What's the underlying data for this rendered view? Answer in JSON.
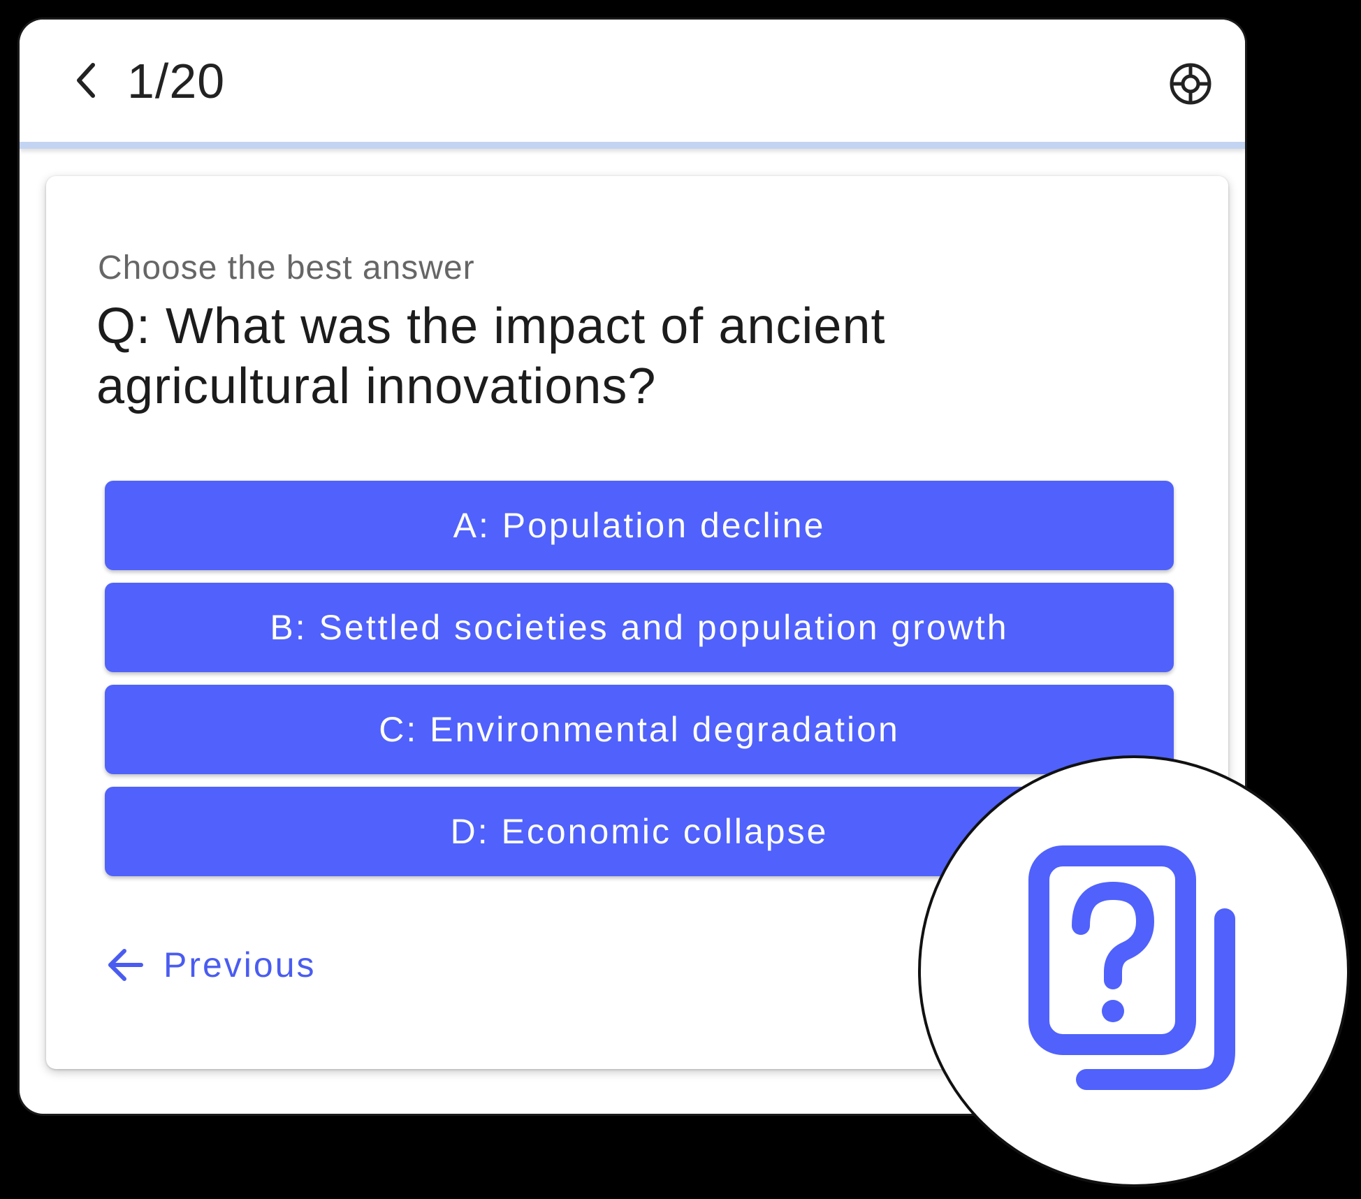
{
  "header": {
    "counter": "1/20",
    "back_icon": "chevron-left-icon",
    "language_icon": "globe-icon"
  },
  "card": {
    "prompt": "Choose the best answer",
    "question": "Q: What was the impact of ancient agricultural innovations?",
    "options": [
      {
        "label": "A: Population decline"
      },
      {
        "label": "B: Settled societies and population growth"
      },
      {
        "label": "C: Environmental degradation"
      },
      {
        "label": "D: Economic collapse"
      }
    ],
    "previous_label": "Previous",
    "previous_icon": "arrow-left-icon"
  },
  "badge": {
    "icon": "question-cards-icon"
  },
  "colors": {
    "accent": "#5062fb",
    "link": "#4a5cf0",
    "progress_track": "#c3d4f2",
    "background": "#000000"
  }
}
